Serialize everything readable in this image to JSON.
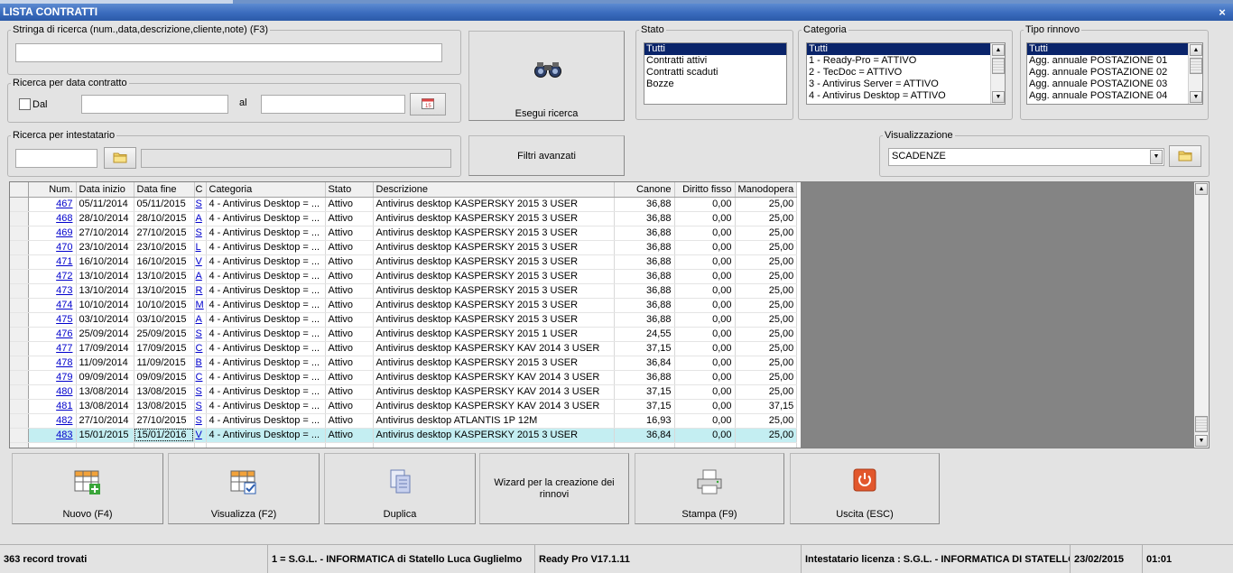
{
  "window": {
    "title": "LISTA CONTRATTI",
    "close_glyph": "×"
  },
  "search": {
    "string_label": "Stringa di ricerca (num.,data,descrizione,cliente,note) (F3)",
    "string_value": "",
    "date_group_label": "Ricerca per data contratto",
    "dal_label": "Dal",
    "dal_checked": false,
    "dal_value": "",
    "al_label": "al",
    "al_value": "",
    "holder_group_label": "Ricerca per intestatario",
    "holder_code": "",
    "holder_name": "",
    "execute_label": "Esegui ricerca",
    "advanced_label": "Filtri avanzati"
  },
  "stato": {
    "label": "Stato",
    "items": [
      "Tutti",
      "Contratti attivi",
      "Contratti scaduti",
      "Bozze"
    ],
    "selected": "Tutti"
  },
  "categoria": {
    "label": "Categoria",
    "items": [
      "Tutti",
      "1 - Ready-Pro = ATTIVO",
      "2 - TecDoc = ATTIVO",
      "3 - Antivirus Server = ATTIVO",
      "4 - Antivirus Desktop = ATTIVO"
    ],
    "selected": "Tutti"
  },
  "tipo_rinnovo": {
    "label": "Tipo rinnovo",
    "items": [
      "Tutti",
      "Agg. annuale POSTAZIONE 01",
      "Agg. annuale POSTAZIONE 02",
      "Agg. annuale POSTAZIONE 03",
      "Agg. annuale POSTAZIONE 04"
    ],
    "selected": "Tutti"
  },
  "visualizzazione": {
    "label": "Visualizzazione",
    "value": "SCADENZE"
  },
  "grid": {
    "columns": [
      "Num.",
      "Data inizio",
      "Data fine",
      "C",
      "Categoria",
      "Stato",
      "Descrizione",
      "Canone",
      "Diritto fisso",
      "Manodopera"
    ],
    "rows": [
      [
        "467",
        "05/11/2014",
        "05/11/2015",
        "S",
        "4 - Antivirus Desktop = ...",
        "Attivo",
        "Antivirus desktop KASPERSKY 2015 3 USER",
        "36,88",
        "0,00",
        "25,00"
      ],
      [
        "468",
        "28/10/2014",
        "28/10/2015",
        "A",
        "4 - Antivirus Desktop = ...",
        "Attivo",
        "Antivirus desktop KASPERSKY 2015 3 USER",
        "36,88",
        "0,00",
        "25,00"
      ],
      [
        "469",
        "27/10/2014",
        "27/10/2015",
        "S",
        "4 - Antivirus Desktop = ...",
        "Attivo",
        "Antivirus desktop KASPERSKY 2015 3 USER",
        "36,88",
        "0,00",
        "25,00"
      ],
      [
        "470",
        "23/10/2014",
        "23/10/2015",
        "L",
        "4 - Antivirus Desktop = ...",
        "Attivo",
        "Antivirus desktop KASPERSKY 2015 3 USER",
        "36,88",
        "0,00",
        "25,00"
      ],
      [
        "471",
        "16/10/2014",
        "16/10/2015",
        "V",
        "4 - Antivirus Desktop = ...",
        "Attivo",
        "Antivirus desktop KASPERSKY 2015 3 USER",
        "36,88",
        "0,00",
        "25,00"
      ],
      [
        "472",
        "13/10/2014",
        "13/10/2015",
        "A",
        "4 - Antivirus Desktop = ...",
        "Attivo",
        "Antivirus desktop KASPERSKY 2015 3 USER",
        "36,88",
        "0,00",
        "25,00"
      ],
      [
        "473",
        "13/10/2014",
        "13/10/2015",
        "R",
        "4 - Antivirus Desktop = ...",
        "Attivo",
        "Antivirus desktop KASPERSKY 2015 3 USER",
        "36,88",
        "0,00",
        "25,00"
      ],
      [
        "474",
        "10/10/2014",
        "10/10/2015",
        "M",
        "4 - Antivirus Desktop = ...",
        "Attivo",
        "Antivirus desktop KASPERSKY 2015 3 USER",
        "36,88",
        "0,00",
        "25,00"
      ],
      [
        "475",
        "03/10/2014",
        "03/10/2015",
        "A",
        "4 - Antivirus Desktop = ...",
        "Attivo",
        "Antivirus desktop KASPERSKY 2015 3 USER",
        "36,88",
        "0,00",
        "25,00"
      ],
      [
        "476",
        "25/09/2014",
        "25/09/2015",
        "S",
        "4 - Antivirus Desktop = ...",
        "Attivo",
        "Antivirus desktop KASPERSKY 2015 1 USER",
        "24,55",
        "0,00",
        "25,00"
      ],
      [
        "477",
        "17/09/2014",
        "17/09/2015",
        "C",
        "4 - Antivirus Desktop = ...",
        "Attivo",
        "Antivirus desktop KASPERSKY KAV 2014 3 USER",
        "37,15",
        "0,00",
        "25,00"
      ],
      [
        "478",
        "11/09/2014",
        "11/09/2015",
        "B",
        "4 - Antivirus Desktop = ...",
        "Attivo",
        "Antivirus desktop KASPERSKY 2015 3 USER",
        "36,84",
        "0,00",
        "25,00"
      ],
      [
        "479",
        "09/09/2014",
        "09/09/2015",
        "C",
        "4 - Antivirus Desktop = ...",
        "Attivo",
        "Antivirus desktop KASPERSKY KAV 2014 3 USER",
        "36,88",
        "0,00",
        "25,00"
      ],
      [
        "480",
        "13/08/2014",
        "13/08/2015",
        "S",
        "4 - Antivirus Desktop = ...",
        "Attivo",
        "Antivirus desktop KASPERSKY KAV 2014 3 USER",
        "37,15",
        "0,00",
        "25,00"
      ],
      [
        "481",
        "13/08/2014",
        "13/08/2015",
        "S",
        "4 - Antivirus Desktop = ...",
        "Attivo",
        "Antivirus desktop KASPERSKY KAV 2014 3 USER",
        "37,15",
        "0,00",
        "37,15"
      ],
      [
        "482",
        "27/10/2014",
        "27/10/2015",
        "S",
        "4 - Antivirus Desktop = ...",
        "Attivo",
        "Antivirus desktop ATLANTIS 1P 12M",
        "16,93",
        "0,00",
        "25,00"
      ],
      [
        "483",
        "15/01/2015",
        "15/01/2016",
        "V",
        "4 - Antivirus Desktop = ...",
        "Attivo",
        "Antivirus desktop KASPERSKY 2015 3 USER",
        "36,84",
        "0,00",
        "25,00"
      ]
    ],
    "current_row": 16
  },
  "actions": {
    "nuovo": "Nuovo (F4)",
    "visualizza": "Visualizza (F2)",
    "duplica": "Duplica",
    "wizard": "Wizard per la creazione dei rinnovi",
    "stampa": "Stampa (F9)",
    "uscita": "Uscita (ESC)"
  },
  "status": {
    "records": "363 record trovati",
    "company": "1 = S.G.L. - INFORMATICA di Statello Luca Guglielmo",
    "version": "Ready Pro V17.1.11",
    "license": "Intestatario licenza : S.G.L. - INFORMATICA DI STATELLO LUCA GUGLIELMO",
    "date": "23/02/2015",
    "time": "01:01"
  }
}
